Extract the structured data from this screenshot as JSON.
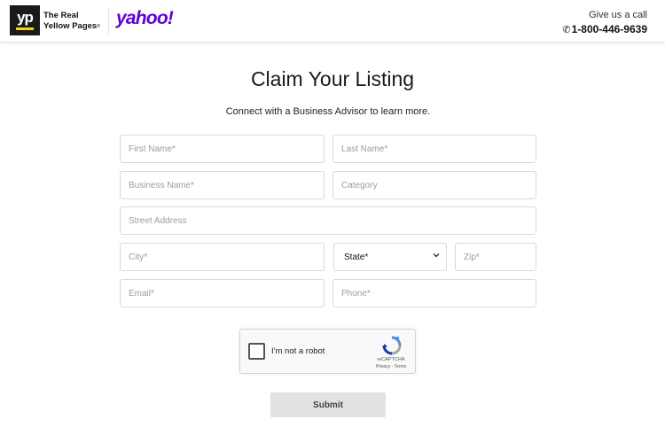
{
  "header": {
    "yp_logo_text": "yp",
    "yp_name_line1": "The Real",
    "yp_name_line2": "Yellow Pages",
    "yp_name_tm": "®",
    "yahoo_logo": "yahoo!",
    "call_label": "Give us a call",
    "call_phone": "1-800-446-9639"
  },
  "form": {
    "title": "Claim Your Listing",
    "subtitle": "Connect with a Business Advisor to learn more.",
    "first_name_placeholder": "First Name*",
    "last_name_placeholder": "Last Name*",
    "business_name_placeholder": "Business Name*",
    "category_placeholder": "Category",
    "street_address_placeholder": "Street Address",
    "city_placeholder": "City*",
    "state_selected": "State*",
    "zip_placeholder": "Zip*",
    "email_placeholder": "Email*",
    "phone_placeholder": "Phone*",
    "submit_label": "Submit"
  },
  "recaptcha": {
    "label": "I'm not a robot",
    "brand": "reCAPTCHA",
    "links": "Privacy - Terms"
  },
  "colors": {
    "yahoo_purple": "#6001d2",
    "yp_yellow": "#f5d117",
    "submit_bg": "#e2e2e2"
  }
}
